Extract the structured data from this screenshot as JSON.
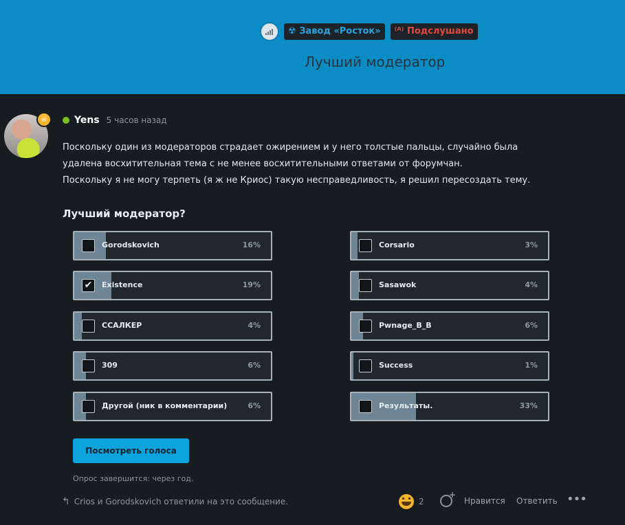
{
  "header": {
    "signal_icon": "signal-strength-icon",
    "chip1_icon": "☢",
    "chip1_text": "Завод «Росток»",
    "chip2_icon": "⁽ᴬ⁾",
    "chip2_text": "Подслушано",
    "title": "Лучший модератор",
    "colors": {
      "background": "#0c8cc5",
      "chip_bg": "#1b2329",
      "chip_blue": "#29a3de",
      "chip_red": "#e5473d"
    }
  },
  "post": {
    "author": "Yens",
    "time": "5 часов назад",
    "badge_icon": "skull-icon",
    "paragraph1": "Поскольку один из модераторов страдает ожирением и у него толстые пальцы, случайно была удалена восхитительная тема с не менее восхитительными ответами от форумчан.",
    "paragraph2": "Поскольку я не могу терпеть (я ж не Криос) такую несправедливость, я решил пересоздать тему."
  },
  "poll": {
    "question": "Лучший модератор?",
    "options": [
      {
        "label": "Gorodskovich",
        "percent": "16%",
        "fill": 0.16,
        "checked": false
      },
      {
        "label": "Corsario",
        "percent": "3%",
        "fill": 0.03,
        "checked": false
      },
      {
        "label": "Existence",
        "percent": "19%",
        "fill": 0.19,
        "checked": true
      },
      {
        "label": "Sasawok",
        "percent": "4%",
        "fill": 0.04,
        "checked": false
      },
      {
        "label": "ССАЛКЕР",
        "percent": "4%",
        "fill": 0.04,
        "checked": false
      },
      {
        "label": "Pwnage_B_B",
        "percent": "6%",
        "fill": 0.06,
        "checked": false
      },
      {
        "label": "309",
        "percent": "6%",
        "fill": 0.06,
        "checked": false
      },
      {
        "label": "Success",
        "percent": "1%",
        "fill": 0.01,
        "checked": false
      },
      {
        "label": "Другой (ник в комментарии)",
        "percent": "6%",
        "fill": 0.06,
        "checked": false
      },
      {
        "label": "Результаты.",
        "percent": "33%",
        "fill": 0.33,
        "checked": false
      }
    ],
    "view_button": "Посмотреть голоса",
    "ends_text": "Опрос завершится: через год."
  },
  "footer": {
    "replied_text": "Crios и Gorodskovich ответили на это сообщение.",
    "reaction_icon": "grinning-squint-emoji-icon",
    "reaction_count": "2",
    "like": "Нравится",
    "reply": "Ответить",
    "more": "•••"
  }
}
